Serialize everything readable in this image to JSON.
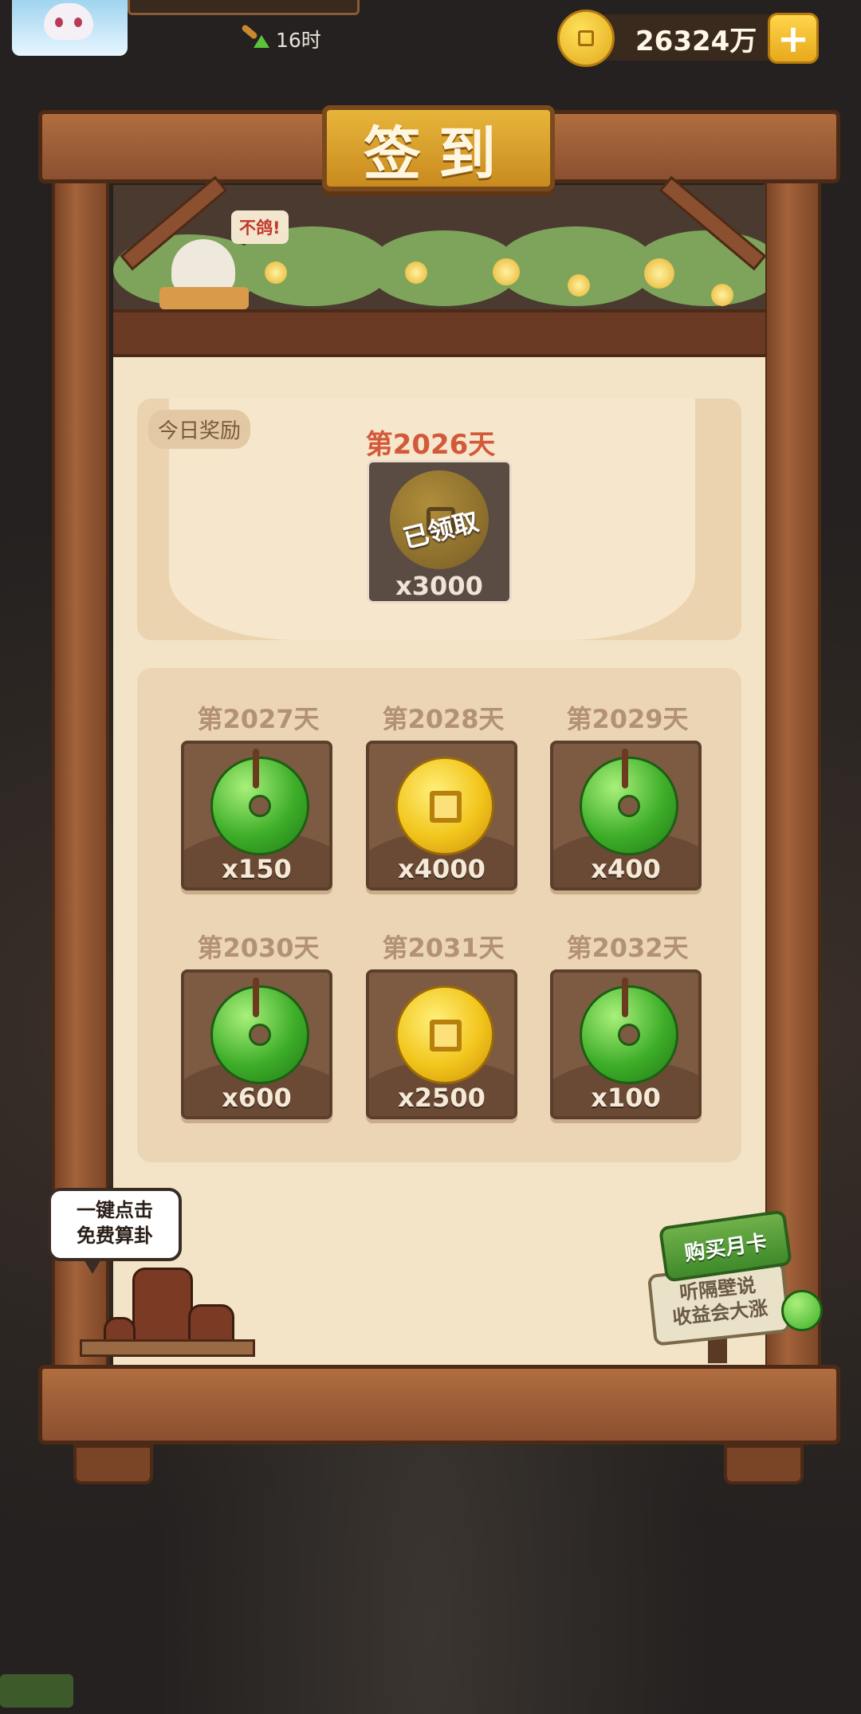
{
  "hud": {
    "timer": "16时",
    "coins": "26324万",
    "plus": "+"
  },
  "title": "签到",
  "garden": {
    "speech": "不鸽!"
  },
  "today": {
    "tag": "今日奖励",
    "day": "第2026天",
    "stamp": "已领取",
    "qty": "x3000",
    "icon": "copper-coin-icon"
  },
  "rewards": [
    {
      "day": "第2027天",
      "qty": "x150",
      "icon": "jade-icon"
    },
    {
      "day": "第2028天",
      "qty": "x4000",
      "icon": "coin-icon"
    },
    {
      "day": "第2029天",
      "qty": "x400",
      "icon": "jade-icon"
    },
    {
      "day": "第2030天",
      "qty": "x600",
      "icon": "jade-icon"
    },
    {
      "day": "第2031天",
      "qty": "x2500",
      "icon": "coin-icon"
    },
    {
      "day": "第2032天",
      "qty": "x100",
      "icon": "jade-icon"
    }
  ],
  "fortune": {
    "line1": "一键点击",
    "line2": "免费算卦"
  },
  "month_card": {
    "tag": "购买月卡",
    "line1": "听隔壁说",
    "line2": "收益会大涨"
  },
  "colors": {
    "day_today": "#d2593a",
    "day_future": "#b29273",
    "panel": "#f3e3c7",
    "wood": "#8a5030",
    "gold": "#f2c51c",
    "jade": "#3eae29"
  }
}
